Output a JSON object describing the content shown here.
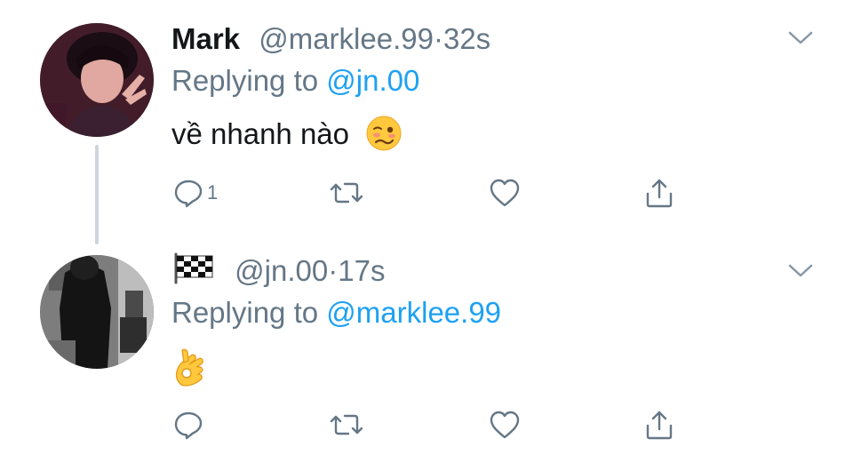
{
  "tweets": [
    {
      "name": "Mark",
      "handle": "@marklee.99",
      "separator": "·",
      "time": "32s",
      "replying_prefix": "Replying to",
      "replying_to": "@jn.00",
      "text": "về nhanh nào",
      "emoji": "woozy-face",
      "reply_count": "1",
      "icons": [
        "reply-icon",
        "retweet-icon",
        "like-icon",
        "share-icon",
        "chevron-down-icon"
      ]
    },
    {
      "name": "🏁",
      "handle": "@jn.00",
      "separator": "·",
      "time": "17s",
      "replying_prefix": "Replying to",
      "replying_to": "@marklee.99",
      "text": "",
      "emoji": "ok-hand",
      "reply_count": "",
      "icons": [
        "reply-icon",
        "retweet-icon",
        "like-icon",
        "share-icon",
        "chevron-down-icon"
      ]
    }
  ],
  "colors": {
    "text": "#14171a",
    "secondary": "#657786",
    "link": "#1da1f2",
    "thread_line": "#cdd6dd"
  }
}
